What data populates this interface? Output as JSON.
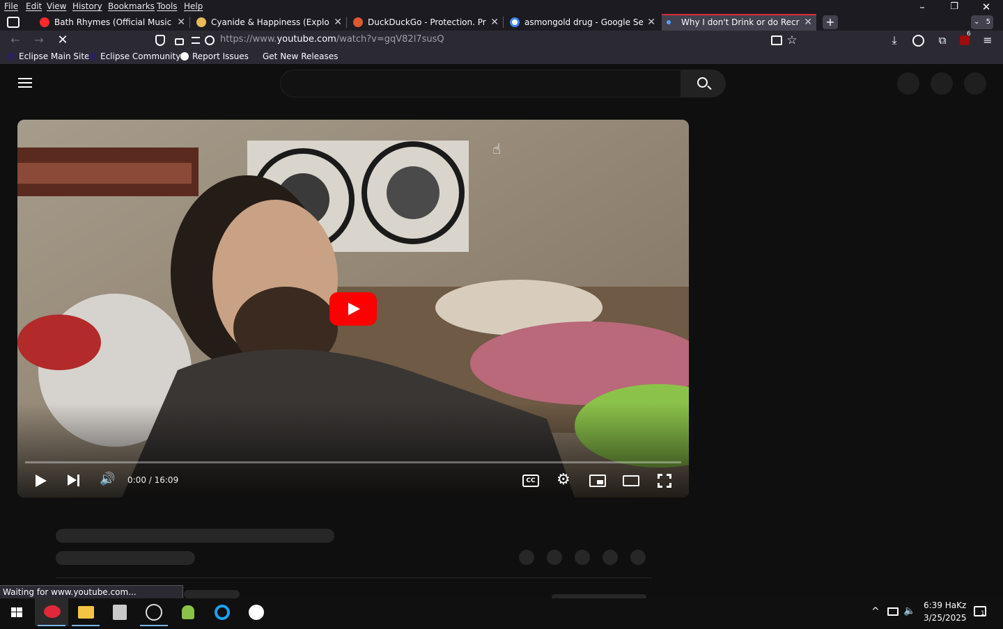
{
  "menu": [
    "File",
    "Edit",
    "View",
    "History",
    "Bookmarks",
    "Tools",
    "Help"
  ],
  "window_controls": {
    "minimize": "–",
    "restore": "❐",
    "close": "✕"
  },
  "tabs": [
    {
      "title": "Bath Rhymes (Official Music Vic",
      "close": "✕"
    },
    {
      "title": "Cyanide & Happiness (Explosm",
      "close": "✕"
    },
    {
      "title": "DuckDuckGo - Protection. Priva",
      "close": "✕"
    },
    {
      "title": "asmongold drug - Google Searc",
      "close": "✕"
    },
    {
      "title": "Why I don't Drink or do Recreati",
      "close": "✕"
    }
  ],
  "new_tab": "+",
  "tab_count": "5",
  "url": {
    "prefix": "https://www.",
    "domain": "youtube.com",
    "path": "/watch?v=gqV82l7susQ"
  },
  "nav": {
    "back": "←",
    "forward": "→",
    "stop": "✕"
  },
  "extension_badge": "6",
  "bookmarks": [
    "Eclipse Main Site",
    "Eclipse Community",
    "Report Issues",
    "Get New Releases"
  ],
  "player": {
    "time": "0:00 / 16:09",
    "cc": "CC",
    "progress": 0
  },
  "status_text": "Waiting for www.youtube.com...",
  "clock": {
    "time": "6:39 HaKz",
    "date": "3/25/2025"
  },
  "notification_count": "1",
  "colors": {
    "accent_tab": "#e0283a",
    "youtube_red": "#ff0000",
    "page_bg": "#0f0f0f"
  }
}
